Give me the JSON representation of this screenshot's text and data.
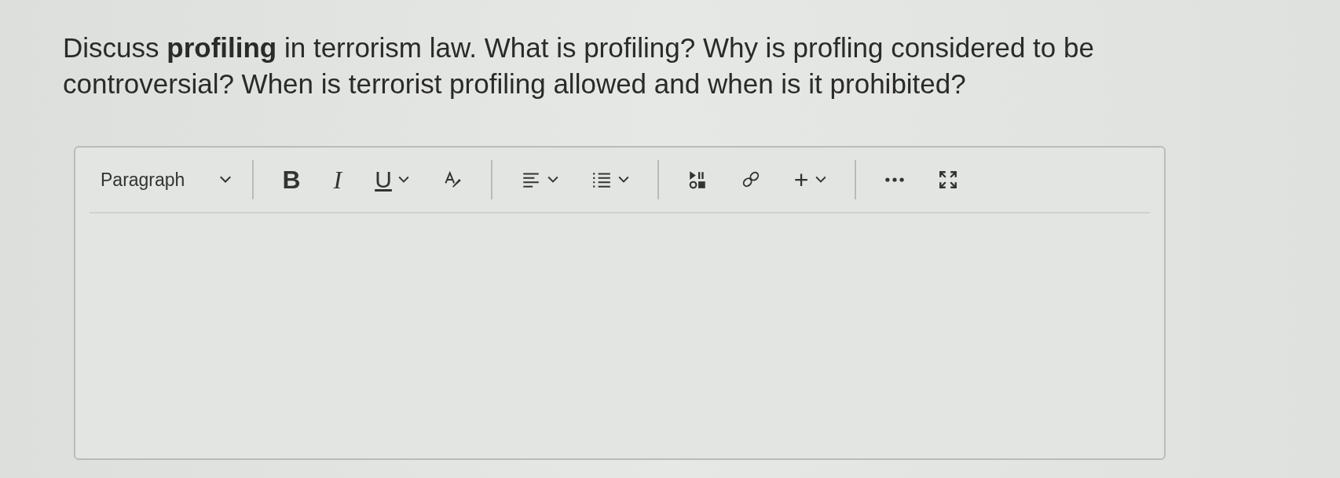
{
  "question": "Discuss **profiling** in terrorism law. What is profiling? Why is profling considered to be controversial? When is terrorist profiling allowed and when is it prohibited?",
  "editor": {
    "block_format": "Paragraph",
    "toolbar_groups": [
      [
        {
          "kind": "bold",
          "label": "B",
          "dropdown": false
        },
        {
          "kind": "italic",
          "label": "I",
          "dropdown": false
        },
        {
          "kind": "underline",
          "label": "U",
          "dropdown": true
        },
        {
          "kind": "text-color",
          "dropdown": false
        }
      ],
      [
        {
          "kind": "align",
          "dropdown": true
        },
        {
          "kind": "list",
          "dropdown": true
        }
      ],
      [
        {
          "kind": "media",
          "dropdown": false
        },
        {
          "kind": "link",
          "dropdown": false
        },
        {
          "kind": "insert",
          "label": "+",
          "dropdown": true
        }
      ],
      [
        {
          "kind": "more",
          "dropdown": false
        },
        {
          "kind": "fullscreen",
          "dropdown": false
        }
      ]
    ]
  }
}
